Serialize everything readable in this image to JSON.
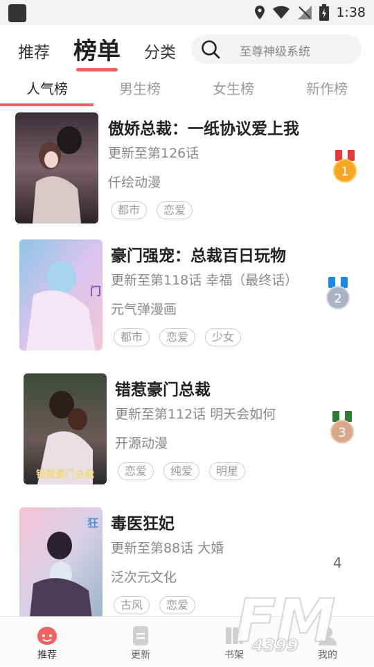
{
  "status_bar": {
    "time": "1:38"
  },
  "header": {
    "tabs": [
      "推荐",
      "榜单",
      "分类"
    ],
    "active_tab": "榜单",
    "search_placeholder": "至尊神级系统"
  },
  "rank_tabs": [
    "人气榜",
    "男生榜",
    "女生榜",
    "新作榜"
  ],
  "comics": [
    {
      "title": "傲娇总裁：一纸协议爱上我",
      "update": "更新至第126话",
      "author": "仟绘动漫",
      "tags": [
        "都市",
        "恋爱"
      ],
      "rank": "1"
    },
    {
      "title": "豪门强宠：总裁百日玩物",
      "update": "更新至第118话 幸福（最终话）",
      "author": "元气弹漫画",
      "tags": [
        "都市",
        "恋爱",
        "少女"
      ],
      "rank": "2"
    },
    {
      "title": "错惹豪门总裁",
      "update": "更新至第112话 明天会如何",
      "author": "开源动漫",
      "tags": [
        "恋爱",
        "纯爱",
        "明星"
      ],
      "rank": "3"
    },
    {
      "title": "毒医狂妃",
      "update": "更新至第88话 大婚",
      "author": "泛次元文化",
      "tags": [
        "古风",
        "恋爱"
      ],
      "rank": "4"
    }
  ],
  "bottom_nav": [
    "推荐",
    "更新",
    "书架",
    "我的"
  ],
  "watermark": {
    "text": "FM",
    "sub": "4399"
  },
  "colors": {
    "accent": "#f06262",
    "gold": "#f5a623",
    "silver": "#a8b4c4",
    "bronze": "#d9a88a"
  }
}
